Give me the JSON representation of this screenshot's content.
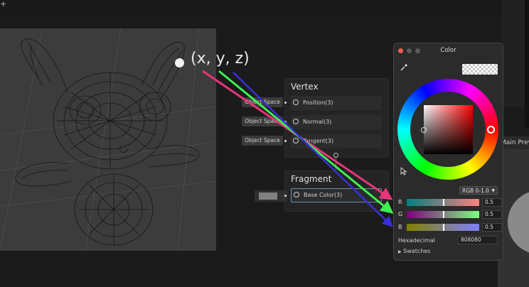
{
  "annotation": {
    "coordinate_label": "(x, y, z)"
  },
  "vertex_node": {
    "title": "Vertex",
    "ports": [
      {
        "space": "Object Space",
        "label": "Position(3)"
      },
      {
        "space": "Object Space",
        "label": "Normal(3)"
      },
      {
        "space": "Object Space",
        "label": "Tangent(3)"
      }
    ]
  },
  "fragment_node": {
    "title": "Fragment",
    "ports": [
      {
        "label": "Base Color(3)"
      }
    ]
  },
  "main_preview": {
    "title": "Main Preview"
  },
  "color_picker": {
    "title": "Color",
    "mode": "RGB 0-1.0",
    "channels": [
      {
        "label": "R",
        "value": "0.5",
        "fraction": 0.5
      },
      {
        "label": "G",
        "value": "0.5",
        "fraction": 0.5
      },
      {
        "label": "B",
        "value": "0.5",
        "fraction": 0.5
      }
    ],
    "hex_label": "Hexadecimal",
    "hex_value": "808080",
    "swatches_label": "Swatches"
  },
  "colors": {
    "arrow_red": "#e8347a",
    "arrow_green": "#3ef052",
    "arrow_blue": "#3a2fd8",
    "base_color": "#808080"
  },
  "icons": [
    "plus-icon",
    "eyedropper-icon",
    "cursor-icon",
    "chevron-down-icon",
    "triangle-right-icon"
  ]
}
